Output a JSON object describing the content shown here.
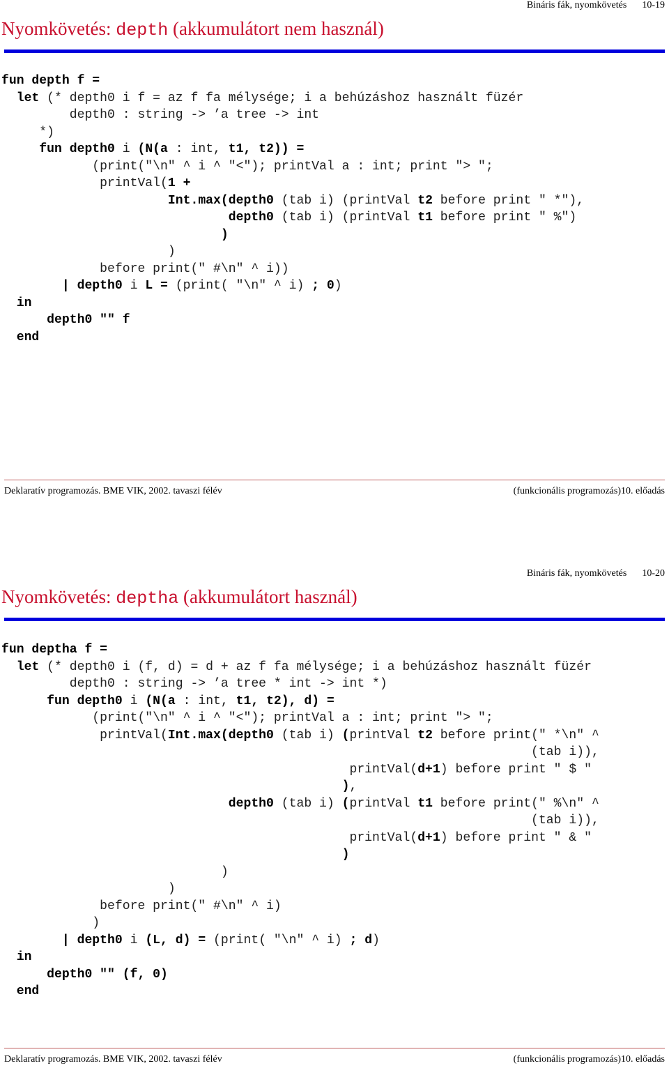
{
  "slides": [
    {
      "topic": "Bináris fák, nyomkövetés",
      "page": "10-19",
      "title_prefix": "Nyomkövetés: ",
      "title_code": "depth",
      "title_suffix": " (akkumulátort nem használ)",
      "code": [
        [
          [
            "fun depth f =",
            true
          ]
        ],
        [
          [
            "  ",
            false
          ],
          [
            "let",
            true
          ],
          [
            " (* depth0 i f = az f fa mélysége; i a behúzáshoz használt füzér",
            false
          ]
        ],
        [
          [
            "         depth0 : string -> ’a tree -> int",
            false
          ]
        ],
        [
          [
            "     *)",
            false
          ]
        ],
        [
          [
            "     ",
            false
          ],
          [
            "fun depth0",
            true
          ],
          [
            " i ",
            false
          ],
          [
            "(N(a",
            true
          ],
          [
            " : int, ",
            false
          ],
          [
            "t1, t2)) =",
            true
          ]
        ],
        [
          [
            "            (print(\"\\n\" ^ i ^ \"<\"); printVal a : int; print \"> \";",
            false
          ]
        ],
        [
          [
            "             printVal(",
            false
          ],
          [
            "1 +",
            true
          ]
        ],
        [
          [
            "                      ",
            false
          ],
          [
            "Int.max(depth0",
            true
          ],
          [
            " (tab i) (printVal ",
            false
          ],
          [
            "t2",
            true
          ],
          [
            " before print \" *\"),",
            false
          ]
        ],
        [
          [
            "                              ",
            false
          ],
          [
            "depth0",
            true
          ],
          [
            " (tab i) (printVal ",
            false
          ],
          [
            "t1",
            true
          ],
          [
            " before print \" %\")",
            false
          ]
        ],
        [
          [
            "                             ",
            false
          ],
          [
            ")",
            true
          ]
        ],
        [
          [
            "                      )",
            false
          ]
        ],
        [
          [
            "             before print(\" #\\n\" ^ i))",
            false
          ]
        ],
        [
          [
            "        ",
            false
          ],
          [
            "| depth0",
            true
          ],
          [
            " i ",
            false
          ],
          [
            "L =",
            true
          ],
          [
            " (print( \"\\n\" ^ i) ",
            false
          ],
          [
            "; 0",
            true
          ],
          [
            ")",
            false
          ]
        ],
        [
          [
            "  ",
            false
          ],
          [
            "in",
            true
          ]
        ],
        [
          [
            "      ",
            false
          ],
          [
            "depth0 \"\" f",
            true
          ]
        ],
        [
          [
            "  ",
            false
          ],
          [
            "end",
            true
          ]
        ]
      ],
      "footer_left": "Deklaratív programozás. BME VIK, 2002. tavaszi félév",
      "footer_right": "(funkcionális programozás)10. előadás"
    },
    {
      "topic": "Bináris fák, nyomkövetés",
      "page": "10-20",
      "title_prefix": "Nyomkövetés: ",
      "title_code": "deptha",
      "title_suffix": " (akkumulátort használ)",
      "code": [
        [
          [
            "fun deptha f =",
            true
          ]
        ],
        [
          [
            "  ",
            false
          ],
          [
            "let",
            true
          ],
          [
            " (* depth0 i (f, d) = d + az f fa mélysége; i a behúzáshoz használt füzér",
            false
          ]
        ],
        [
          [
            "         depth0 : string -> ’a tree * int -> int *)",
            false
          ]
        ],
        [
          [
            "      ",
            false
          ],
          [
            "fun depth0",
            true
          ],
          [
            " i ",
            false
          ],
          [
            "(N(a",
            true
          ],
          [
            " : int, ",
            false
          ],
          [
            "t1, t2), d) =",
            true
          ]
        ],
        [
          [
            "            (print(\"\\n\" ^ i ^ \"<\"); printVal a : int; print \"> \";",
            false
          ]
        ],
        [
          [
            "             printVal(",
            false
          ],
          [
            "Int.max(depth0",
            true
          ],
          [
            " (tab i) ",
            false
          ],
          [
            "(",
            true
          ],
          [
            "printVal ",
            false
          ],
          [
            "t2",
            true
          ],
          [
            " before print(\" *\\n\" ^",
            false
          ]
        ],
        [
          [
            "                                                                      (tab i)),",
            false
          ]
        ],
        [
          [
            "                                              printVal(",
            false
          ],
          [
            "d+1",
            true
          ],
          [
            ") before print \" $ \"",
            false
          ]
        ],
        [
          [
            "                                             ",
            false
          ],
          [
            ")",
            true
          ],
          [
            ",",
            false
          ]
        ],
        [
          [
            "                              ",
            false
          ],
          [
            "depth0",
            true
          ],
          [
            " (tab i) ",
            false
          ],
          [
            "(",
            true
          ],
          [
            "printVal ",
            false
          ],
          [
            "t1",
            true
          ],
          [
            " before print(\" %\\n\" ^",
            false
          ]
        ],
        [
          [
            "                                                                      (tab i)),",
            false
          ]
        ],
        [
          [
            "                                              printVal(",
            false
          ],
          [
            "d+1",
            true
          ],
          [
            ") before print \" & \"",
            false
          ]
        ],
        [
          [
            "                                             ",
            false
          ],
          [
            ")",
            true
          ]
        ],
        [
          [
            "                             )",
            false
          ]
        ],
        [
          [
            "                      )",
            false
          ]
        ],
        [
          [
            "             before print(\" #\\n\" ^ i)",
            false
          ]
        ],
        [
          [
            "            )",
            false
          ]
        ],
        [
          [
            "        ",
            false
          ],
          [
            "| depth0",
            true
          ],
          [
            " i ",
            false
          ],
          [
            "(L, d) =",
            true
          ],
          [
            " (print( \"\\n\" ^ i) ",
            false
          ],
          [
            "; d",
            true
          ],
          [
            ")",
            false
          ]
        ],
        [
          [
            "  ",
            false
          ],
          [
            "in",
            true
          ]
        ],
        [
          [
            "      ",
            false
          ],
          [
            "depth0 \"\" (f, 0)",
            true
          ]
        ],
        [
          [
            "  ",
            false
          ],
          [
            "end",
            true
          ]
        ]
      ],
      "footer_left": "Deklaratív programozás. BME VIK, 2002. tavaszi félév",
      "footer_right": "(funkcionális programozás)10. előadás"
    }
  ],
  "colors": {
    "title": "#c8102e",
    "rule": "#0000dd",
    "footer_rule": "#c06060"
  }
}
